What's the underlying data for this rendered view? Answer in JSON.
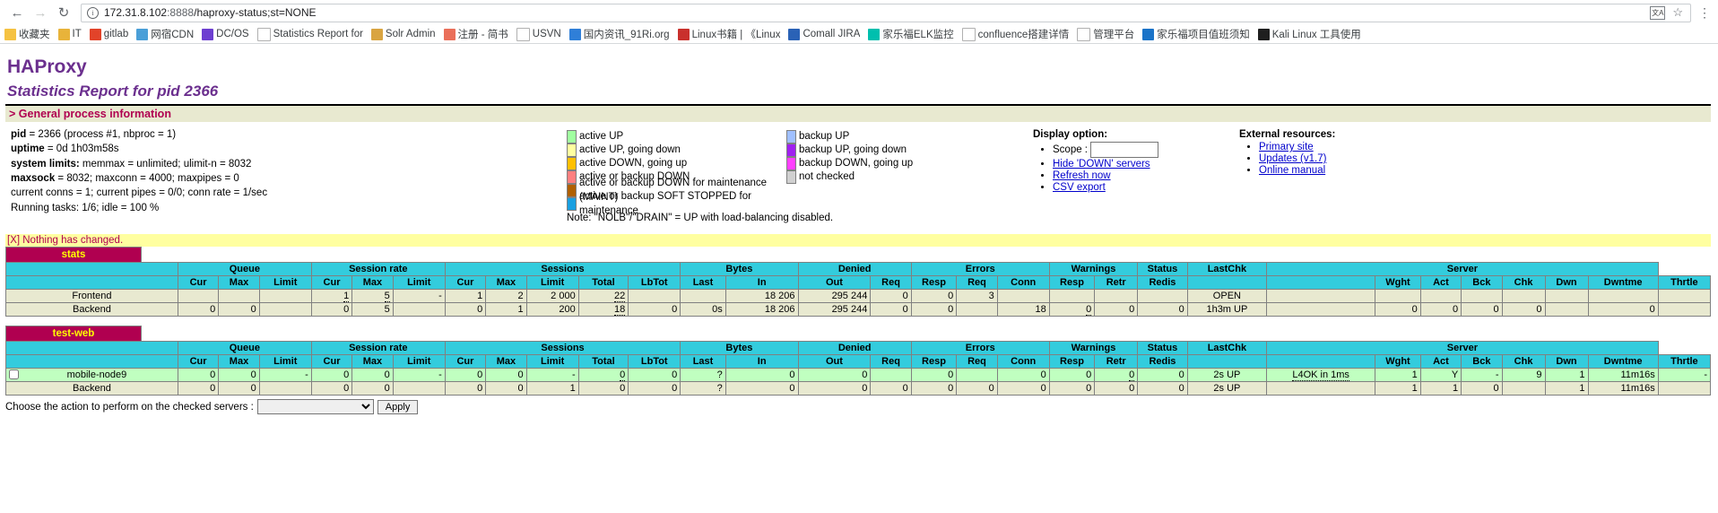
{
  "browser": {
    "back_icon": "back-arrow-icon",
    "forward_icon": "forward-arrow-icon",
    "reload_icon": "reload-icon",
    "url_host": "172.31.8.102",
    "url_port": ":8888",
    "url_path": "/haproxy-status;st=NONE",
    "translate_icon": "translate-icon",
    "star_icon": "bookmark-star-icon",
    "menu_icon": "browser-menu-icon",
    "bookmarks": [
      {
        "label": "收藏夹",
        "color": "#f5c242"
      },
      {
        "label": "IT",
        "color": "#e8b33a"
      },
      {
        "label": "gitlab",
        "color": "#e24329"
      },
      {
        "label": "网宿CDN",
        "color": "#4a9fd8"
      },
      {
        "label": "DC/OS",
        "color": "#6d3fd1"
      },
      {
        "label": "Statistics Report for",
        "color": "#ffffff"
      },
      {
        "label": "Solr Admin",
        "color": "#d9a441"
      },
      {
        "label": "注册 - 简书",
        "color": "#ea6f5a"
      },
      {
        "label": "USVN",
        "color": "#ffffff"
      },
      {
        "label": "国内资讯_91Ri.org",
        "color": "#2f7fd8"
      },
      {
        "label": "Linux书籍 | 《Linux",
        "color": "#c9302c"
      },
      {
        "label": "Comall JIRA",
        "color": "#2a62b6"
      },
      {
        "label": "家乐福ELK监控",
        "color": "#00bfae"
      },
      {
        "label": "confluence搭建详情",
        "color": "#ffffff"
      },
      {
        "label": "管理平台",
        "color": "#ffffff"
      },
      {
        "label": "家乐福项目值班须知",
        "color": "#1a73c8"
      },
      {
        "label": "Kali Linux 工具使用",
        "color": "#1f1f1f"
      }
    ]
  },
  "header": {
    "title": "HAProxy",
    "subtitle": "Statistics Report for pid 2366"
  },
  "general": {
    "section_title": "> General process information",
    "lines": [
      {
        "bold": "pid",
        "rest": " = 2366 (process #1, nbproc = 1)"
      },
      {
        "bold": "uptime",
        "rest": " = 0d 1h03m58s"
      },
      {
        "bold": "system limits:",
        "rest": " memmax = unlimited; ulimit-n = 8032"
      },
      {
        "bold": "maxsock",
        "rest": " = 8032; maxconn = 4000; maxpipes = 0"
      },
      {
        "bold": "",
        "rest": "current conns = 1; current pipes = 0/0; conn rate = 1/sec"
      },
      {
        "bold": "",
        "rest": "Running tasks: 1/6; idle = 100 %"
      }
    ]
  },
  "legend": {
    "left": [
      {
        "label": "active UP",
        "color": "#a0ffa0"
      },
      {
        "label": "active UP, going down",
        "color": "#ffffa0"
      },
      {
        "label": "active DOWN, going up",
        "color": "#ffc000"
      },
      {
        "label": "active or backup DOWN",
        "color": "#ff8080"
      },
      {
        "label": "active or backup DOWN for maintenance (MAINT)",
        "color": "#b06000"
      },
      {
        "label": "active or backup SOFT STOPPED for maintenance",
        "color": "#1a9fe0"
      }
    ],
    "right": [
      {
        "label": "backup UP",
        "color": "#a0c0ff"
      },
      {
        "label": "backup UP, going down",
        "color": "#a020f0"
      },
      {
        "label": "backup DOWN, going up",
        "color": "#ff40ff"
      },
      {
        "label": "not checked",
        "color": "#d0d0d0"
      }
    ],
    "note": "Note: \"NOLB\"/\"DRAIN\" = UP with load-balancing disabled."
  },
  "display_option": {
    "title": "Display option:",
    "scope_label": "Scope :",
    "scope_value": "",
    "links": [
      "Hide 'DOWN' servers",
      "Refresh now",
      "CSV export"
    ]
  },
  "external": {
    "title": "External resources:",
    "links": [
      "Primary site",
      "Updates (v1.7)",
      "Online manual"
    ]
  },
  "status_message": "[X] Nothing has changed.",
  "proxies": [
    {
      "name": "stats",
      "has_checkbox": false,
      "group_headers": [
        {
          "label": "",
          "span": 1
        },
        {
          "label": "Queue",
          "span": 3
        },
        {
          "label": "Session rate",
          "span": 3
        },
        {
          "label": "Sessions",
          "span": 5
        },
        {
          "label": "Bytes",
          "span": 2
        },
        {
          "label": "Denied",
          "span": 2
        },
        {
          "label": "Errors",
          "span": 3
        },
        {
          "label": "Warnings",
          "span": 2
        },
        {
          "label": "Status",
          "span": 1
        },
        {
          "label": "LastChk",
          "span": 1
        },
        {
          "label": "Server",
          "span": 7
        }
      ],
      "col_headers": [
        "",
        "Cur",
        "Max",
        "Limit",
        "Cur",
        "Max",
        "Limit",
        "Cur",
        "Max",
        "Limit",
        "Total",
        "LbTot",
        "Last",
        "In",
        "Out",
        "Req",
        "Resp",
        "Req",
        "Conn",
        "Resp",
        "Retr",
        "Redis",
        "",
        "",
        "Wght",
        "Act",
        "Bck",
        "Chk",
        "Dwn",
        "Dwntme",
        "Thrtle"
      ],
      "rows": [
        {
          "type": "frontend",
          "name": "Frontend",
          "cells": [
            "",
            "",
            "",
            "1",
            "5",
            "-",
            "1",
            "2",
            "2 000",
            "22",
            "",
            "",
            "18 206",
            "295 244",
            "0",
            "0",
            "3",
            "",
            "",
            "",
            "",
            "OPEN",
            "",
            "",
            "",
            "",
            "",
            "",
            "",
            ""
          ],
          "underline": [
            3,
            4,
            9
          ],
          "status_col": 21
        },
        {
          "type": "backend",
          "name": "Backend",
          "cells": [
            "0",
            "0",
            "",
            "0",
            "5",
            "",
            "0",
            "1",
            "200",
            "18",
            "0",
            "0s",
            "18 206",
            "295 244",
            "0",
            "0",
            "",
            "18",
            "0",
            "0",
            "0",
            "1h3m UP",
            "",
            "0",
            "0",
            "0",
            "0",
            "",
            "0",
            ""
          ],
          "underline": [
            9,
            18
          ],
          "status_col": 21
        }
      ]
    },
    {
      "name": "test-web",
      "has_checkbox": true,
      "group_headers": [
        {
          "label": "",
          "span": 1
        },
        {
          "label": "Queue",
          "span": 3
        },
        {
          "label": "Session rate",
          "span": 3
        },
        {
          "label": "Sessions",
          "span": 5
        },
        {
          "label": "Bytes",
          "span": 2
        },
        {
          "label": "Denied",
          "span": 2
        },
        {
          "label": "Errors",
          "span": 3
        },
        {
          "label": "Warnings",
          "span": 2
        },
        {
          "label": "Status",
          "span": 1
        },
        {
          "label": "LastChk",
          "span": 1
        },
        {
          "label": "Server",
          "span": 7
        }
      ],
      "col_headers": [
        "",
        "Cur",
        "Max",
        "Limit",
        "Cur",
        "Max",
        "Limit",
        "Cur",
        "Max",
        "Limit",
        "Total",
        "LbTot",
        "Last",
        "In",
        "Out",
        "Req",
        "Resp",
        "Req",
        "Conn",
        "Resp",
        "Retr",
        "Redis",
        "",
        "",
        "Wght",
        "Act",
        "Bck",
        "Chk",
        "Dwn",
        "Dwntme",
        "Thrtle"
      ],
      "rows": [
        {
          "type": "server",
          "name": "mobile-node9",
          "cells": [
            "0",
            "0",
            "-",
            "0",
            "0",
            "-",
            "0",
            "0",
            "-",
            "0",
            "0",
            "?",
            "0",
            "0",
            "",
            "0",
            "",
            "0",
            "0",
            "0",
            "0",
            "2s UP",
            "L4OK in 1ms",
            "1",
            "Y",
            "-",
            "9",
            "1",
            "11m16s",
            "-"
          ],
          "underline": [
            9,
            19
          ],
          "link_cols": [
            22
          ],
          "status_col": 21
        },
        {
          "type": "backend",
          "name": "Backend",
          "cells": [
            "0",
            "0",
            "",
            "0",
            "0",
            "",
            "0",
            "0",
            "1",
            "0",
            "0",
            "?",
            "0",
            "0",
            "0",
            "0",
            "0",
            "0",
            "0",
            "0",
            "0",
            "2s UP",
            "",
            "1",
            "1",
            "0",
            "",
            "1",
            "11m16s",
            ""
          ],
          "underline": [],
          "status_col": 21
        }
      ]
    }
  ],
  "action_bar": {
    "label": "Choose the action to perform on the checked servers :",
    "select_value": "",
    "apply_label": "Apply"
  }
}
